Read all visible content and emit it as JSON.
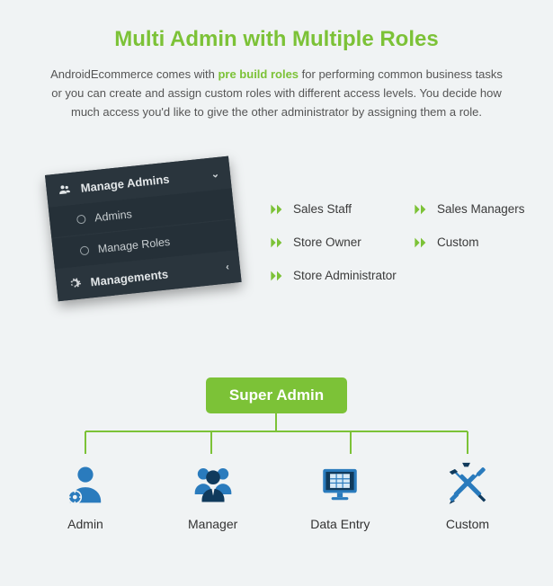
{
  "heading": "Multi Admin with Multiple Roles",
  "subtext": {
    "pre": "AndroidEcommerce comes with ",
    "em": "pre build roles",
    "post": " for performing common business tasks or you can create and assign custom roles with different access levels. You decide how much access you'd like to give the other administrator by assigning them a role."
  },
  "sidebar": {
    "header": "Manage Admins",
    "items": [
      "Admins",
      "Manage Roles"
    ],
    "footer": "Managements"
  },
  "roles": [
    "Sales Staff",
    "Sales Managers",
    "Store Owner",
    "Custom",
    "Store Administrator"
  ],
  "org": {
    "root": "Super Admin",
    "children": [
      "Admin",
      "Manager",
      "Data Entry",
      "Custom"
    ]
  },
  "colors": {
    "accent": "#7cc237",
    "iconBlue": "#2a7bbd"
  }
}
